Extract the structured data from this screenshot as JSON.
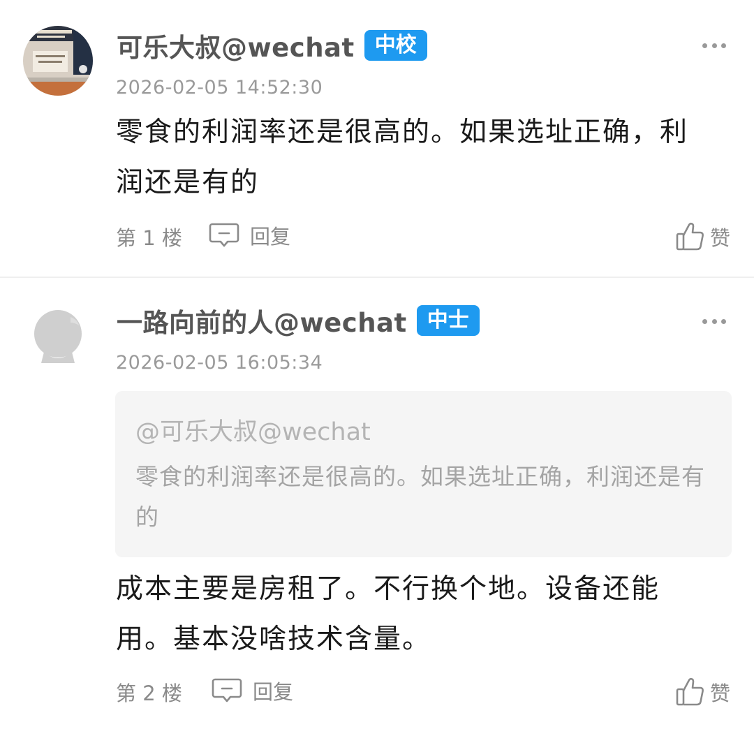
{
  "comments": [
    {
      "username": "可乐大叔@wechat",
      "badge": "中校",
      "timestamp": "2026-02-05 14:52:30",
      "body": "零食的利润率还是很高的。如果选址正确，利润还是有的",
      "floor": "第 1 楼",
      "reply_label": "回复",
      "like_label": "赞"
    },
    {
      "username": "一路向前的人@wechat",
      "badge": "中士",
      "timestamp": "2026-02-05 16:05:34",
      "quote": {
        "author": "@可乐大叔@wechat",
        "text": "零食的利润率还是很高的。如果选址正确，利润还是有的"
      },
      "body": "成本主要是房租了。不行换个地。设备还能用。基本没啥技术含量。",
      "floor": "第 2 楼",
      "reply_label": "回复",
      "like_label": "赞"
    }
  ],
  "colors": {
    "badge": "#1e9af0",
    "username": "#555555",
    "meta": "#9a9a9a",
    "quote_bg": "#f5f5f5"
  },
  "icons": [
    "more-icon",
    "reply-icon",
    "like-icon",
    "avatar-image",
    "default-avatar-icon"
  ]
}
